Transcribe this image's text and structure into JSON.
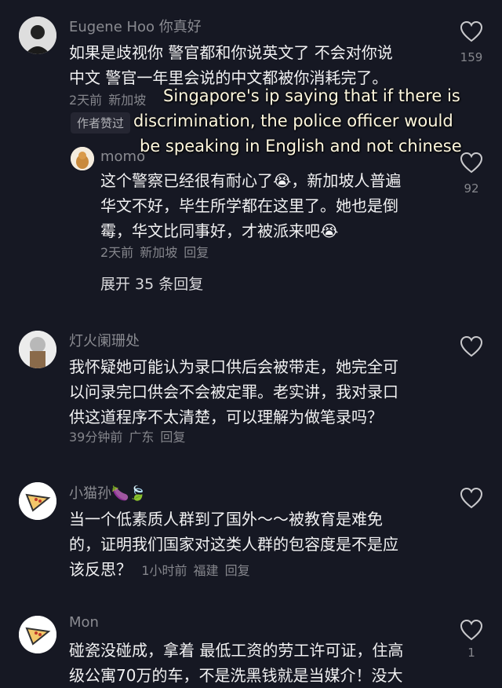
{
  "comments": [
    {
      "username": "Eugene Hoo 你真好",
      "text_lines": [
        "如果是歧视你 警官都和你说英文了 不会对你说",
        "中文 警官一年里会说的中文都被你消耗完了。"
      ],
      "time": "2天前",
      "location": "新加坡",
      "author_liked": "作者赞过",
      "likes": "159",
      "reply": {
        "username": "momo",
        "text_lines": [
          "这个警察已经很有耐心了😭，新加坡人普遍",
          "华文不好，毕生所学都在这里了。她也是倒",
          "霉，华文比同事好，才被派来吧😭"
        ],
        "time": "2天前",
        "location": "新加坡",
        "reply_label": "回复",
        "likes": "92"
      },
      "expand_label": "展开 35 条回复"
    },
    {
      "username": "灯火阑珊处",
      "text_lines": [
        "我怀疑她可能认为录口供后会被带走，她完全可",
        "以问录完口供会不会被定罪。老实讲，我对录口",
        "供这道程序不太清楚，可以理解为做笔录吗？"
      ],
      "time": "39分钟前",
      "location": "广东",
      "reply_label": "回复",
      "likes": ""
    },
    {
      "username": "小猫孙🍆🍃",
      "text_lines": [
        "当一个低素质人群到了国外～～被教育是难免",
        "的，证明我们国家对这类人群的包容度是不是应",
        "该反思？"
      ],
      "time": "1小时前",
      "location": "福建",
      "reply_label": "回复",
      "likes": ""
    },
    {
      "username": "Mon",
      "text_lines": [
        "碰瓷没碰成，拿着 最低工资的劳工许可证，住高",
        "级公寓70万的车，不是洗黑钱就是当媒介！没大"
      ],
      "likes": "1"
    }
  ],
  "overlay_caption": [
    "Singapore's ip saying that if there is",
    "discrimination, the police officer would",
    "be speaking in English and not chinese"
  ]
}
